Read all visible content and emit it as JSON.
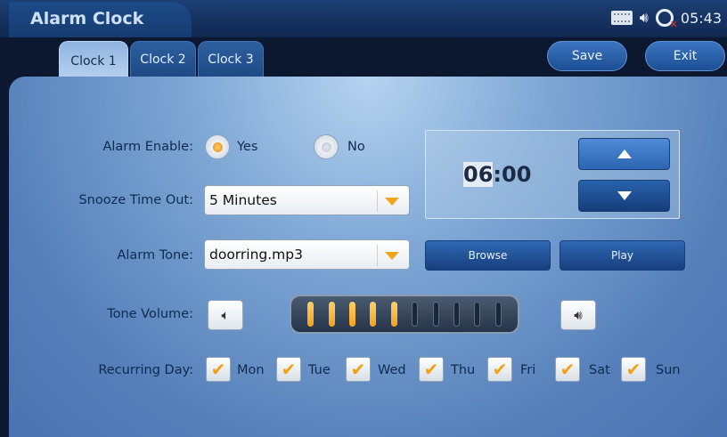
{
  "window": {
    "title": "Alarm Clock"
  },
  "status": {
    "time": "05:43",
    "icons": [
      "keyboard-icon",
      "speaker-icon",
      "alarm-off-icon"
    ]
  },
  "tabs": [
    {
      "label": "Clock 1",
      "active": true
    },
    {
      "label": "Clock 2",
      "active": false
    },
    {
      "label": "Clock 3",
      "active": false
    }
  ],
  "toolbar": {
    "save_label": "Save",
    "exit_label": "Exit"
  },
  "alarm_enable": {
    "label": "Alarm Enable:",
    "yes_label": "Yes",
    "no_label": "No",
    "selected": "Yes"
  },
  "snooze": {
    "label": "Snooze Time Out:",
    "value": "5 Minutes"
  },
  "alarm_time": {
    "hours": "06",
    "separator": ":",
    "minutes": "00"
  },
  "tone": {
    "label": "Alarm Tone:",
    "value": "doorring.mp3",
    "browse_label": "Browse",
    "play_label": "Play"
  },
  "volume": {
    "label": "Tone Volume:",
    "level": 5,
    "max": 10
  },
  "recurring": {
    "label": "Recurring Day:",
    "days": [
      {
        "name": "Mon",
        "checked": true
      },
      {
        "name": "Tue",
        "checked": true
      },
      {
        "name": "Wed",
        "checked": true
      },
      {
        "name": "Thu",
        "checked": true
      },
      {
        "name": "Fri",
        "checked": true
      },
      {
        "name": "Sat",
        "checked": true
      },
      {
        "name": "Sun",
        "checked": true
      }
    ]
  },
  "colors": {
    "accent": "#f2a71b",
    "panel": "#7ea7d5",
    "titlebar": "#163c70"
  }
}
